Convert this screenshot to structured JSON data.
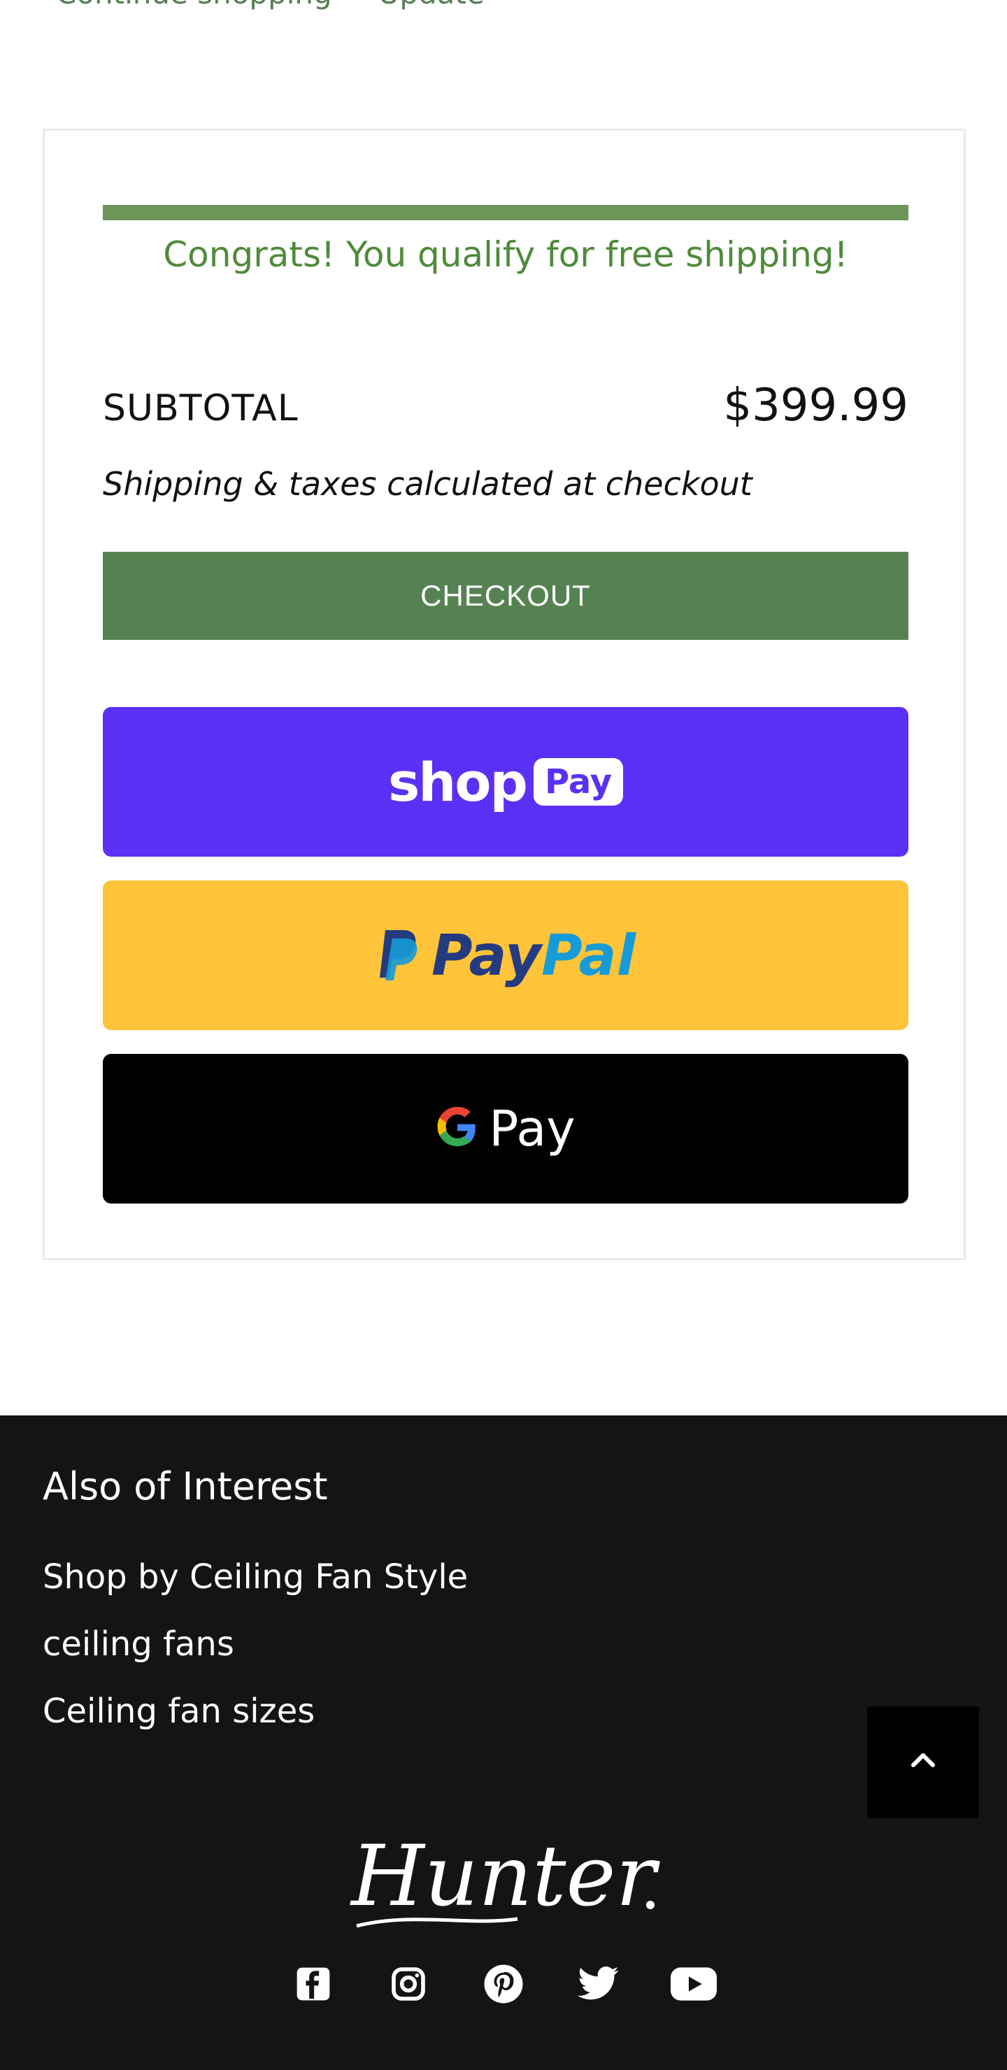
{
  "top_links": {
    "continue_shopping": "Continue shopping",
    "update": "Update"
  },
  "cart": {
    "shipping_message": "Congrats! You qualify for free shipping!",
    "subtotal_label": "SUBTOTAL",
    "subtotal_value": "$399.99",
    "shipping_note": "Shipping & taxes calculated at checkout",
    "checkout_label": "CHECKOUT",
    "free_shipping_progress": 1.0
  },
  "payments": {
    "shop_pay": {
      "shop": "shop",
      "pay": "Pay"
    },
    "paypal": {
      "pay": "Pay",
      "pal": "Pal"
    },
    "google_pay": {
      "pay": "Pay"
    }
  },
  "footer": {
    "title": "Also of Interest",
    "links": [
      "Shop by Ceiling Fan Style",
      "ceiling fans",
      "Ceiling fan sizes"
    ],
    "logo_text": "Hunter",
    "social_icons": [
      "facebook-icon",
      "instagram-icon",
      "pinterest-icon",
      "twitter-icon",
      "youtube-icon"
    ]
  },
  "colors": {
    "accent_green": "#568251",
    "shop_pay_purple": "#5a31f4",
    "paypal_yellow": "#ffc43a",
    "footer_bg": "#141414"
  }
}
